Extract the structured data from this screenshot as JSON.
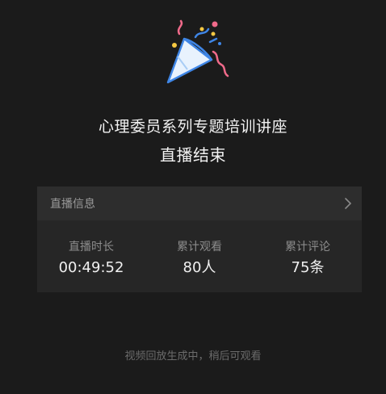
{
  "event": {
    "title": "心理委员系列专题培训讲座",
    "status": "直播结束"
  },
  "info_card": {
    "header_label": "直播信息",
    "header_icon": "chevron-right-icon",
    "stats": [
      {
        "label": "直播时长",
        "value": "00:49:52"
      },
      {
        "label": "累计观看",
        "value": "80人"
      },
      {
        "label": "累计评论",
        "value": "75条"
      }
    ]
  },
  "footer": {
    "note": "视频回放生成中，稍后可观看"
  },
  "icons": {
    "hero": "party-popper-icon"
  },
  "colors": {
    "background": "#1b1b1b",
    "card": "#262626",
    "card_header": "#2d2d2d",
    "popper_blue": "#3f86e6",
    "confetti_pink": "#f06a8a",
    "confetti_yellow": "#f5c842"
  }
}
